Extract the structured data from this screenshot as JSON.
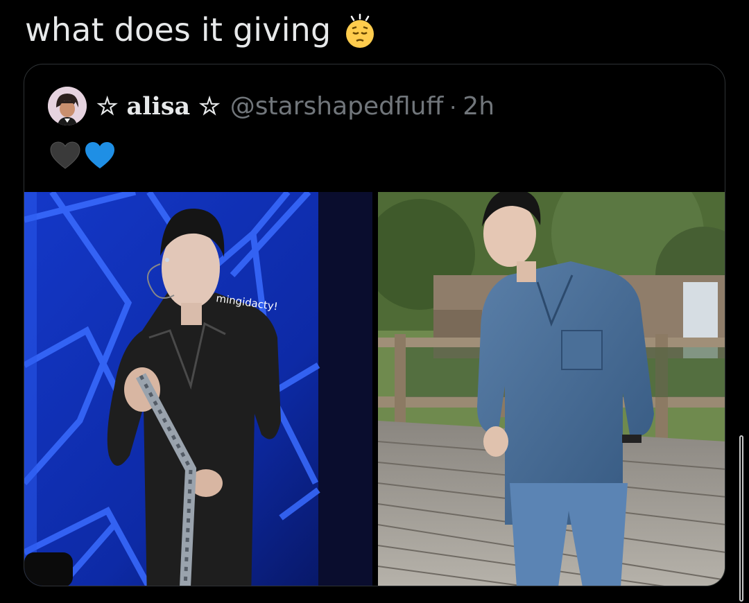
{
  "tweet": {
    "text": "what does it giving",
    "emoji": "pensive-face"
  },
  "quoted_tweet": {
    "display_name": "☆ alisa ☆",
    "handle": "@starshapedfluff",
    "separator": "·",
    "timestamp": "2h",
    "body_emojis": [
      "black-heart",
      "blue-heart"
    ],
    "media": [
      {
        "description": "performer in black satin shirt on blue-lit stage",
        "watermark": "mingidacty!"
      },
      {
        "description": "man in denim shirt and jeans on wooden boardwalk"
      }
    ]
  },
  "colors": {
    "background": "#000000",
    "text_primary": "#e7e9ea",
    "text_secondary": "#71767b",
    "border": "#2f3336"
  }
}
